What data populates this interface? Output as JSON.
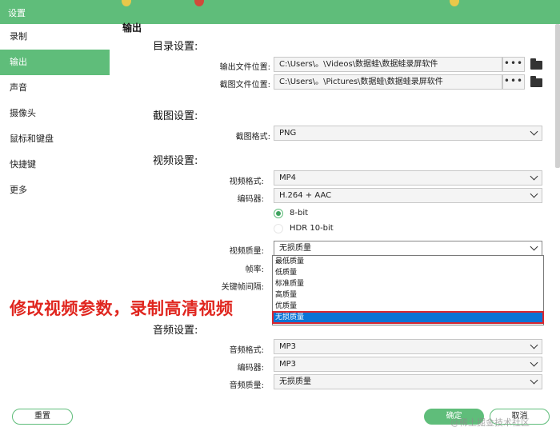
{
  "window": {
    "title": "设置",
    "accent": "#5fbd7a"
  },
  "sidebar": {
    "items": [
      {
        "label": "录制",
        "active": false
      },
      {
        "label": "输出",
        "active": true
      },
      {
        "label": "声音",
        "active": false
      },
      {
        "label": "摄像头",
        "active": false
      },
      {
        "label": "鼠标和键盘",
        "active": false
      },
      {
        "label": "快捷键",
        "active": false
      },
      {
        "label": "更多",
        "active": false
      }
    ]
  },
  "main": {
    "section_header": "输出",
    "directory": {
      "title": "目录设置:",
      "output_label": "输出文件位置:",
      "output_path": "C:\\Users\\。\\Videos\\数据蛙\\数据蛙录屏软件",
      "screenshot_label": "截图文件位置:",
      "screenshot_path": "C:\\Users\\。\\Pictures\\数据蛙\\数据蛙录屏软件",
      "browse_label": "•••"
    },
    "screenshot": {
      "title": "截图设置:",
      "format_label": "截图格式:",
      "format_value": "PNG"
    },
    "video": {
      "title": "视频设置:",
      "format_label": "视频格式:",
      "format_value": "MP4",
      "encoder_label": "编码器:",
      "encoder_value": "H.264 + AAC",
      "bit_8": "8-bit",
      "bit_10": "HDR 10-bit",
      "quality_label": "视频质量:",
      "quality_value": "无损质量",
      "framerate_label": "帧率:",
      "keyframe_label": "关键帧间隔:",
      "quality_options": [
        "最低质量",
        "低质量",
        "标准质量",
        "高质量",
        "优质量",
        "无损质量"
      ]
    },
    "audio": {
      "title": "音频设置:",
      "format_label": "音频格式:",
      "format_value": "MP3",
      "encoder_label": "编码器:",
      "encoder_value": "MP3",
      "quality_label": "音频质量:",
      "quality_value": "无损质量"
    }
  },
  "annotation": {
    "text": "修改视频参数，录制高清视频",
    "color": "#e0261f"
  },
  "footer": {
    "reset_label": "重置",
    "ok_label": "确定",
    "cancel_label": "取消"
  },
  "watermark": "@稀土掘金技术社区"
}
